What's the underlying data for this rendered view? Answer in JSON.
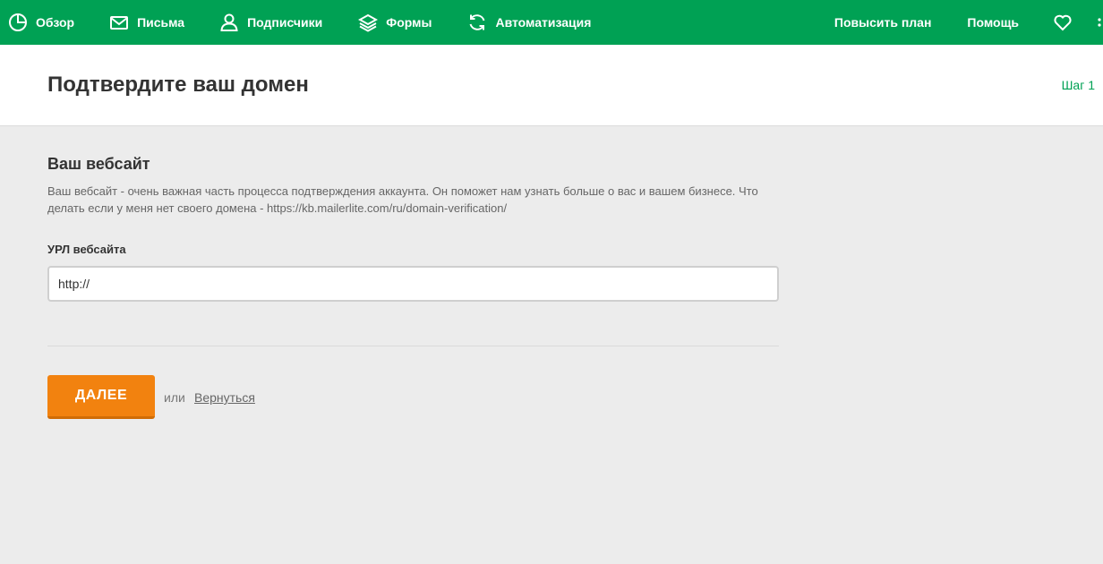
{
  "nav": {
    "items": [
      {
        "label": "Обзор",
        "icon": "pie-chart-icon"
      },
      {
        "label": "Письма",
        "icon": "envelope-icon"
      },
      {
        "label": "Подписчики",
        "icon": "user-icon"
      },
      {
        "label": "Формы",
        "icon": "layers-icon"
      },
      {
        "label": "Автоматизация",
        "icon": "refresh-icon"
      }
    ],
    "upgrade_label": "Повысить план",
    "help_label": "Помощь",
    "favorites_icon": "heart-icon"
  },
  "header": {
    "title": "Подтвердите ваш домен",
    "step": "Шаг 1"
  },
  "form": {
    "section_title": "Ваш вебсайт",
    "description": "Ваш вебсайт - очень важная часть процесса подтверждения аккаунта. Он поможет нам узнать больше о вас и вашем бизнесе. Что делать если у меня нет своего домена - https://kb.mailerlite.com/ru/domain-verification/",
    "url_label": "УРЛ вебсайта",
    "url_value": "http://",
    "next_label": "ДАЛЕЕ",
    "or_text": "или",
    "back_label": "Вернуться"
  },
  "colors": {
    "brand_green": "#00a154",
    "accent_orange": "#f2820f",
    "background": "#ececec"
  }
}
